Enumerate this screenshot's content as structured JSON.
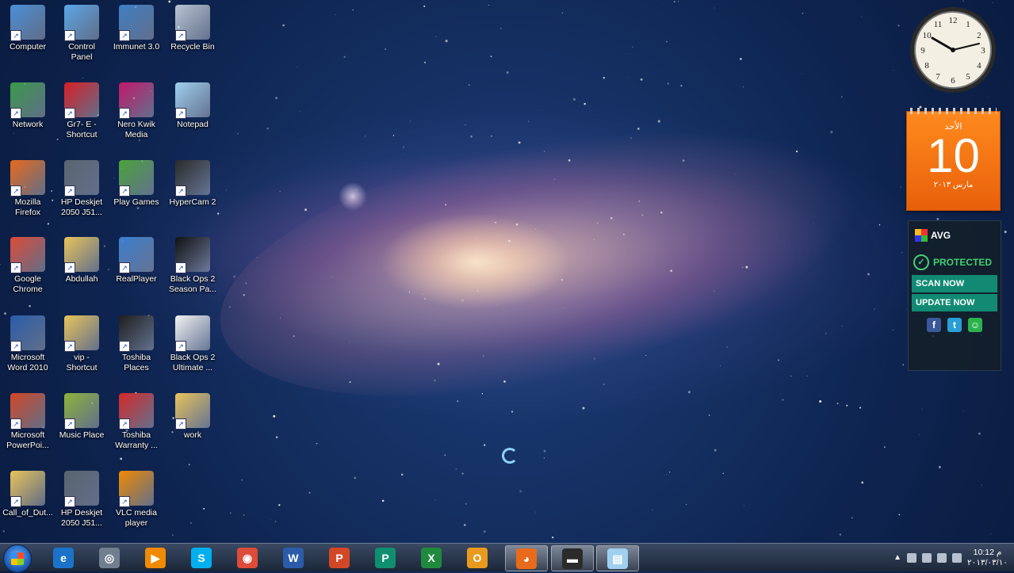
{
  "desktop_icons": [
    {
      "label": "Computer",
      "icon": "computer-icon",
      "color": "#4a90d9"
    },
    {
      "label": "Control\nPanel",
      "icon": "control-panel-icon",
      "color": "#5aa7e8"
    },
    {
      "label": "Immunet 3.0",
      "icon": "immunet-icon",
      "color": "#3d7fc4"
    },
    {
      "label": "Recycle Bin",
      "icon": "recycle-bin-icon",
      "color": "#b8c4d2"
    },
    {
      "label": "Network",
      "icon": "network-icon",
      "color": "#3a9a4b"
    },
    {
      "label": "Gr7- E -\nShortcut",
      "icon": "pdf-icon",
      "color": "#d81f26"
    },
    {
      "label": "Nero Kwik\nMedia",
      "icon": "nero-icon",
      "color": "#c2186b"
    },
    {
      "label": "Notepad",
      "icon": "notepad-icon",
      "color": "#9fd0ef"
    },
    {
      "label": "Mozilla\nFirefox",
      "icon": "firefox-icon",
      "color": "#e86a1b"
    },
    {
      "label": "HP Deskjet\n2050 J51...",
      "icon": "scanner-icon",
      "color": "#5a6470"
    },
    {
      "label": "Play Games",
      "icon": "games-icon",
      "color": "#4aa33a"
    },
    {
      "label": "HyperCam 2",
      "icon": "hypercam-icon",
      "color": "#2b2b2b"
    },
    {
      "label": "Google\nChrome",
      "icon": "chrome-icon",
      "color": "#dd4b39"
    },
    {
      "label": "Abdullah",
      "icon": "user-folder-icon",
      "color": "#e8c45a"
    },
    {
      "label": "RealPlayer",
      "icon": "realplayer-icon",
      "color": "#3b7fd1"
    },
    {
      "label": "Black Ops 2\nSeason Pa...",
      "icon": "black-ops-icon",
      "color": "#111111"
    },
    {
      "label": "Microsoft\nWord 2010",
      "icon": "word-icon",
      "color": "#2a5caa"
    },
    {
      "label": "vip -\nShortcut",
      "icon": "folder-icon",
      "color": "#e8c45a"
    },
    {
      "label": "Toshiba\nPlaces",
      "icon": "toshiba-places-icon",
      "color": "#1e1e1e"
    },
    {
      "label": "Black Ops 2\nUltimate ...",
      "icon": "black-ops-c-icon",
      "color": "#f2f2f2"
    },
    {
      "label": "Microsoft\nPowerPoi...",
      "icon": "powerpoint-icon",
      "color": "#d24726"
    },
    {
      "label": "Music Place",
      "icon": "music-place-icon",
      "color": "#8fb33a"
    },
    {
      "label": "Toshiba\nWarranty ...",
      "icon": "toshiba-warranty-icon",
      "color": "#d62828"
    },
    {
      "label": "work",
      "icon": "folder-icon",
      "color": "#e8c45a"
    },
    {
      "label": "Call_of_Dut...",
      "icon": "folder-icon",
      "color": "#e8c45a"
    },
    {
      "label": "HP Deskjet\n2050 J51...",
      "icon": "printer-icon",
      "color": "#5a6470"
    },
    {
      "label": "VLC media\nplayer",
      "icon": "vlc-icon",
      "color": "#f08a00"
    }
  ],
  "calendar": {
    "day_name": "الأحد",
    "day_number": "10",
    "month_year": "مارس ٢٠١٣"
  },
  "avg": {
    "brand": "AVG",
    "status": "PROTECTED",
    "scan_label": "SCAN NOW",
    "update_label": "UPDATE NOW",
    "social": [
      {
        "icon": "facebook-icon",
        "glyph": "f",
        "color": "#3b5998"
      },
      {
        "icon": "twitter-icon",
        "glyph": "t",
        "color": "#2a9fd6"
      },
      {
        "icon": "avg-community-icon",
        "glyph": "☺",
        "color": "#2bb24c"
      }
    ]
  },
  "taskbar": {
    "items": [
      {
        "icon": "internet-explorer-icon",
        "glyph": "e",
        "color": "#1a73c9",
        "active": false
      },
      {
        "icon": "media-center-icon",
        "glyph": "◎",
        "color": "#6f7f8f",
        "active": false
      },
      {
        "icon": "media-player-icon",
        "glyph": "▶",
        "color": "#f08a00",
        "active": false
      },
      {
        "icon": "skype-icon",
        "glyph": "S",
        "color": "#00aff0",
        "active": false
      },
      {
        "icon": "chrome-icon",
        "glyph": "◉",
        "color": "#dd4b39",
        "active": false
      },
      {
        "icon": "word-icon",
        "glyph": "W",
        "color": "#2a5caa",
        "active": false
      },
      {
        "icon": "powerpoint-icon",
        "glyph": "P",
        "color": "#d24726",
        "active": false
      },
      {
        "icon": "publisher-icon",
        "glyph": "P",
        "color": "#0f8f6f",
        "active": false
      },
      {
        "icon": "excel-icon",
        "glyph": "X",
        "color": "#1f8a3d",
        "active": false
      },
      {
        "icon": "outlook-icon",
        "glyph": "O",
        "color": "#e99a1e",
        "active": false
      },
      {
        "icon": "firefox-icon",
        "glyph": "◕",
        "color": "#e86a1b",
        "active": true
      },
      {
        "icon": "hypercam-icon",
        "glyph": "▬",
        "color": "#2b2b2b",
        "active": true
      },
      {
        "icon": "notepad-icon",
        "glyph": "▤",
        "color": "#9fd0ef",
        "active": true
      }
    ],
    "time": "10:12 م",
    "date": "٢٠١٣/٠٣/١٠"
  }
}
